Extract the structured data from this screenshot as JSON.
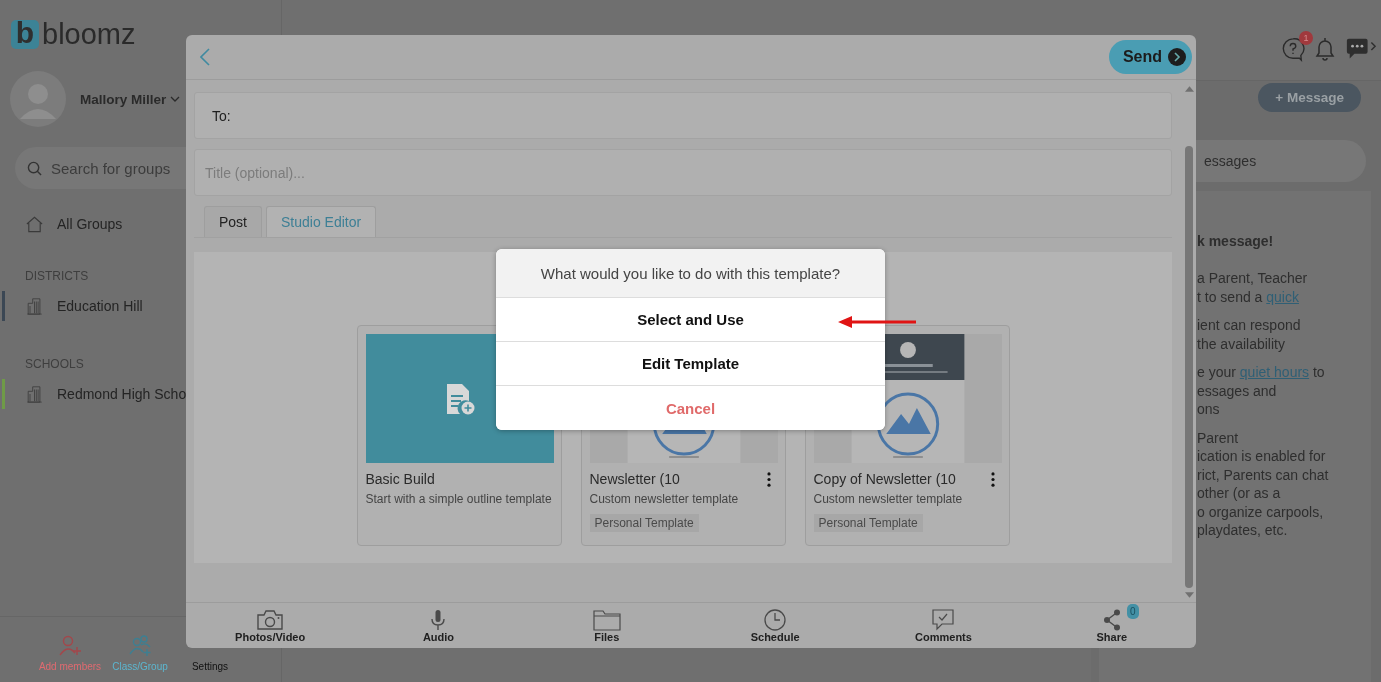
{
  "brand": {
    "letter": "b",
    "name": "bloomz"
  },
  "user": {
    "name": "Mallory Miller"
  },
  "search": {
    "placeholder": "Search for groups"
  },
  "nav": {
    "all_groups": "All Groups",
    "sections": [
      {
        "heading": "DISTRICTS",
        "items": [
          {
            "label": "Education Hill",
            "color": "#3b4754"
          }
        ]
      },
      {
        "heading": "SCHOOLS",
        "items": [
          {
            "label": "Redmond High Scho",
            "color": "#6f9b47"
          }
        ]
      }
    ]
  },
  "sidebar_actions": [
    {
      "label": "Add members",
      "kind": "add-member"
    },
    {
      "label": "Class/Group",
      "kind": "class"
    },
    {
      "label": "Settings",
      "kind": "settings"
    }
  ],
  "header": {
    "help_badge": "1",
    "new_message": "+ Message"
  },
  "right_panel": {
    "search_fragment": "essages",
    "heading": "k message!",
    "paragraphs": [
      [
        [
          {
            "text": "a Parent, Teacher"
          }
        ],
        [
          {
            "text": "t to send a "
          },
          {
            "text": "quick",
            "link": true
          }
        ]
      ],
      [
        [
          {
            "text": "ient can respond"
          }
        ],
        [
          {
            "text": " the availability"
          }
        ]
      ],
      [
        [
          {
            "text": "e your "
          },
          {
            "text": "quiet hours",
            "link": true
          },
          {
            "text": " to"
          }
        ],
        [
          {
            "text": "essages and"
          }
        ],
        [
          {
            "text": "ons"
          }
        ]
      ],
      [
        [
          {
            "text": "Parent"
          }
        ],
        [
          {
            "text": "ication is enabled for"
          }
        ],
        [
          {
            "text": "rict, Parents can chat"
          }
        ],
        [
          {
            "text": "other (or as a"
          }
        ],
        [
          {
            "text": "o organize carpools,"
          }
        ],
        [
          {
            "text": "playdates, etc."
          }
        ]
      ]
    ]
  },
  "composer": {
    "send": "Send",
    "to_label": "To:",
    "title_placeholder": "Title (optional)...",
    "tabs": [
      {
        "label": "Post",
        "selected": false
      },
      {
        "label": "Studio Editor",
        "selected": true
      }
    ]
  },
  "templates": [
    {
      "kind": "blank",
      "title": "Basic Build",
      "description": "Start with a simple outline template"
    },
    {
      "kind": "custom",
      "title": "Newsletter (10",
      "description": "Custom newsletter template",
      "tag": "Personal Template"
    },
    {
      "kind": "custom",
      "title": "Copy of Newsletter (10",
      "description": "Custom newsletter template",
      "tag": "Personal Template"
    }
  ],
  "toolbar": [
    {
      "label": "Photos/Video",
      "kind": "camera"
    },
    {
      "label": "Audio",
      "kind": "mic"
    },
    {
      "label": "Files",
      "kind": "folder"
    },
    {
      "label": "Schedule",
      "kind": "clock"
    },
    {
      "label": "Comments",
      "kind": "comment"
    },
    {
      "label": "Share",
      "kind": "share",
      "badge": "0"
    }
  ],
  "action_sheet": {
    "question": "What would you like to do with this template?",
    "actions": [
      {
        "label": "Select and Use",
        "kind": "default"
      },
      {
        "label": "Edit Template",
        "kind": "default"
      },
      {
        "label": "Cancel",
        "kind": "destructive"
      }
    ]
  }
}
